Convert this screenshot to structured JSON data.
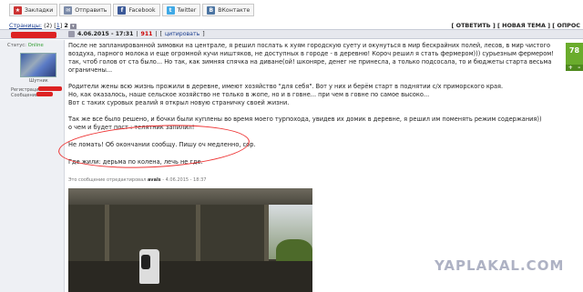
{
  "share": {
    "bookmarks": "Закладки",
    "send": "Отправить",
    "facebook": "Facebook",
    "twitter": "Twitter",
    "vkontakte": "ВКонтакте"
  },
  "nav": {
    "pages_label": "Страницы:",
    "total": "(2)",
    "page1": "1",
    "page2": "2",
    "right": "[ ОТВЕТИТЬ ] [ НОВАЯ ТЕМА ] [ ОПРОС"
  },
  "post": {
    "date": "4.06.2015 - 17:31",
    "id": "911",
    "cite": "цитировать",
    "status": "Статус:",
    "online": "Online",
    "rank": "Шутник",
    "registration": "Регистрация:",
    "messages": "Сообщений:",
    "rating": "78",
    "vote_plus": "+",
    "vote_minus": "–",
    "p1": "После не запланированной зимовки на централе, я решил послать к хуям городскую суету и окунуться в мир бескрайних полей, лесов, в мир чистого воздуха, парного молока и еще огромной кучи ништяков, не доступных в городе - в деревню! Короч решил я стать фермером))) сурьезным фермером! так, чтоб голов от ста было... Но так, как зимняя спячка на диване(ой! шконяре, денег не принесла, а только подсосала, то и бюджеты старта весьма ограничены...",
    "p2a": "Родители жены всю жизнь прожили в деревне, имеют хозяйство \"для себя\". Вот у них и берём старт в поднятии с/х приморского края.",
    "p2b": "Но, как оказалось, наше сельское хозяйство не только в жопе, но и в говне... при чем в говне по самое высоко...",
    "p2c": "Вот с таких суровых реалий я открыл новую страничку своей жизни.",
    "p3a": "Так же все было решено, и бочки были куплены во время моего турпохода, увидев их домик в деревне, я решил им поменять режим содержания))",
    "p3b": "о чем и будет пост : телятник запилил!",
    "p4": "Не ломать! Об окончании сообщу. Пишу оч медленно, сор.",
    "p5": "Где жили: дерьма по колена, лечь не где.",
    "edited_prefix": "Это сообщение отредактировал",
    "edited_user": "avals",
    "edited_time": "- 4.06.2015 - 18:37"
  },
  "watermark": "YAPLAKAL.COM",
  "colors": {
    "accent_red": "#cc0000",
    "link_blue": "#1a3d8f",
    "rating_green": "#6aac2c"
  }
}
